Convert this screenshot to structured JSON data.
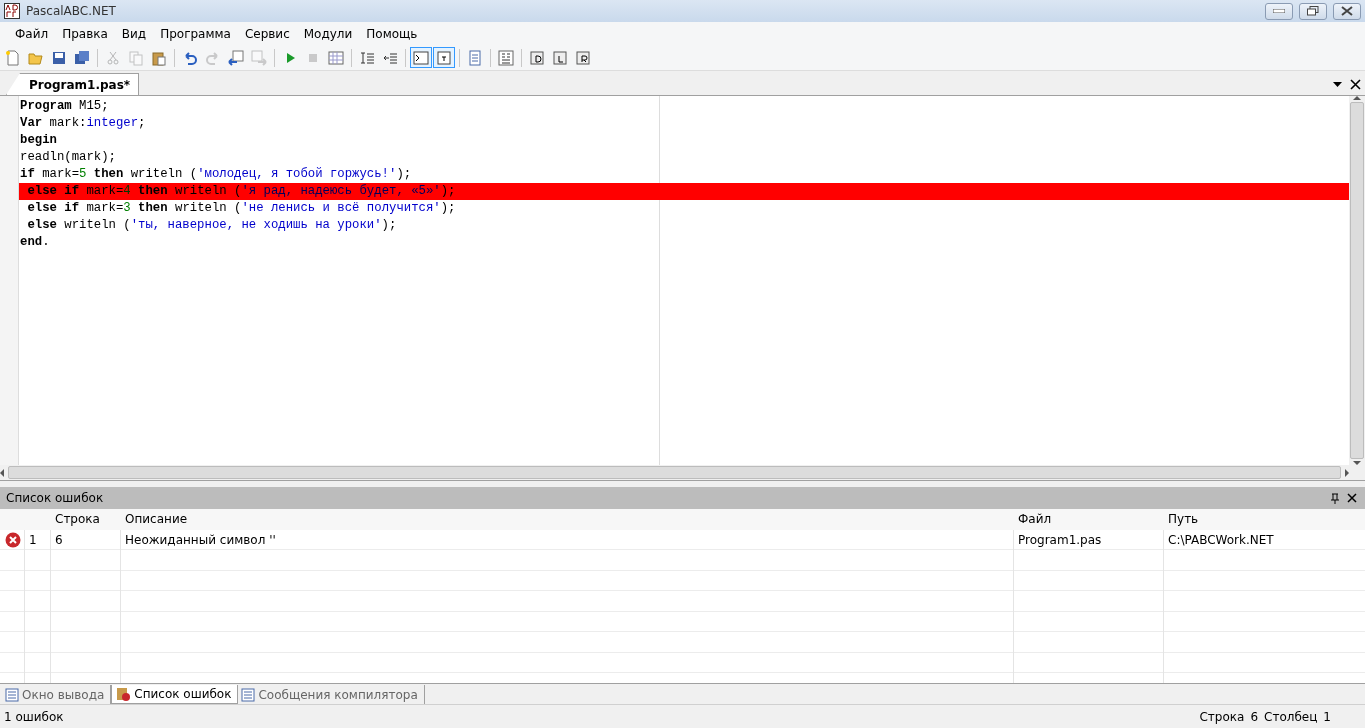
{
  "window": {
    "title": "PascalABC.NET"
  },
  "menu": [
    "Файл",
    "Правка",
    "Вид",
    "Программа",
    "Сервис",
    "Модули",
    "Помощь"
  ],
  "toolbar": [
    {
      "pressed": false,
      "disabled": false
    },
    {
      "pressed": false,
      "disabled": false
    },
    {
      "pressed": false,
      "disabled": false
    },
    {
      "pressed": false,
      "disabled": false
    },
    {
      "pressed": false,
      "disabled": true
    },
    {
      "pressed": false,
      "disabled": true
    },
    {
      "pressed": false,
      "disabled": false
    },
    {
      "pressed": false,
      "disabled": false
    },
    {
      "pressed": false,
      "disabled": true
    },
    {
      "pressed": false,
      "disabled": false
    },
    {
      "pressed": false,
      "disabled": true
    },
    {
      "pressed": false,
      "disabled": false
    },
    {
      "pressed": false,
      "disabled": true
    },
    {
      "pressed": false,
      "disabled": false
    },
    {
      "pressed": false,
      "disabled": false
    },
    {
      "pressed": false,
      "disabled": false
    },
    {
      "pressed": true,
      "disabled": false
    },
    {
      "pressed": true,
      "disabled": false
    },
    {
      "pressed": false,
      "disabled": false
    },
    {
      "pressed": false,
      "disabled": false
    },
    {
      "pressed": false,
      "disabled": false
    },
    {
      "pressed": false,
      "disabled": false
    },
    {
      "pressed": false,
      "disabled": false
    }
  ],
  "document_tabs": [
    {
      "label": "Program1.pas*",
      "selected": true
    }
  ],
  "code_lines": [
    {
      "highlighted": false,
      "tokens": [
        {
          "text": "Program",
          "kind": "kw"
        },
        {
          "text": " M15;",
          "kind": "id"
        }
      ]
    },
    {
      "highlighted": false,
      "tokens": [
        {
          "text": "Var",
          "kind": "kw"
        },
        {
          "text": " mark:",
          "kind": "id"
        },
        {
          "text": "integer",
          "kind": "type"
        },
        {
          "text": ";",
          "kind": "id"
        }
      ]
    },
    {
      "highlighted": false,
      "tokens": [
        {
          "text": "begin",
          "kind": "kw"
        }
      ]
    },
    {
      "highlighted": false,
      "tokens": [
        {
          "text": "readln(mark);",
          "kind": "id"
        }
      ]
    },
    {
      "highlighted": false,
      "tokens": [
        {
          "text": "if",
          "kind": "kw"
        },
        {
          "text": " mark=",
          "kind": "id"
        },
        {
          "text": "5",
          "kind": "num"
        },
        {
          "text": " then",
          "kind": "kw"
        },
        {
          "text": " writeln (",
          "kind": "id"
        },
        {
          "text": "'молодец, я тобой горжусь!'",
          "kind": "str"
        },
        {
          "text": ");",
          "kind": "id"
        }
      ]
    },
    {
      "highlighted": true,
      "tokens": [
        {
          "text": " else",
          "kind": "kw"
        },
        {
          "text": " if",
          "kind": "kw"
        },
        {
          "text": " mark=",
          "kind": "id"
        },
        {
          "text": "4",
          "kind": "num"
        },
        {
          "text": " then",
          "kind": "kw"
        },
        {
          "text": " writeln (",
          "kind": "id"
        },
        {
          "text": "'я рад, надеюсь будет, «5»'",
          "kind": "str"
        },
        {
          "text": ");",
          "kind": "id"
        }
      ]
    },
    {
      "highlighted": false,
      "tokens": [
        {
          "text": " else",
          "kind": "kw"
        },
        {
          "text": " if",
          "kind": "kw"
        },
        {
          "text": " mark=",
          "kind": "id"
        },
        {
          "text": "3",
          "kind": "num"
        },
        {
          "text": " then",
          "kind": "kw"
        },
        {
          "text": " writeln (",
          "kind": "id"
        },
        {
          "text": "'не ленись и всё получится'",
          "kind": "str"
        },
        {
          "text": ");",
          "kind": "id"
        }
      ]
    },
    {
      "highlighted": false,
      "tokens": [
        {
          "text": " else",
          "kind": "kw"
        },
        {
          "text": " writeln (",
          "kind": "id"
        },
        {
          "text": "'ты, наверное, не ходишь на уроки'",
          "kind": "str"
        },
        {
          "text": ");",
          "kind": "id"
        }
      ]
    },
    {
      "highlighted": false,
      "tokens": [
        {
          "text": "end",
          "kind": "kw"
        },
        {
          "text": ".",
          "kind": "id"
        }
      ]
    }
  ],
  "error_panel": {
    "title": "Список ошибок",
    "columns": [
      "Строка",
      "Описание",
      "Файл",
      "Путь"
    ],
    "rows": [
      {
        "kind": "error",
        "number": "1",
        "line": "6",
        "description": "Неожиданный символ ''",
        "file": "Program1.pas",
        "path": "C:\\PABCWork.NET"
      }
    ]
  },
  "bottom_tabs": [
    {
      "label": "Окно вывода",
      "selected": false
    },
    {
      "label": "Список ошибок",
      "selected": true
    },
    {
      "label": "Сообщения компилятора",
      "selected": false
    }
  ],
  "status_bar": {
    "message": "1 ошибок",
    "line_label": "Строка",
    "line": "6",
    "column_label": "Столбец",
    "column": "1"
  }
}
